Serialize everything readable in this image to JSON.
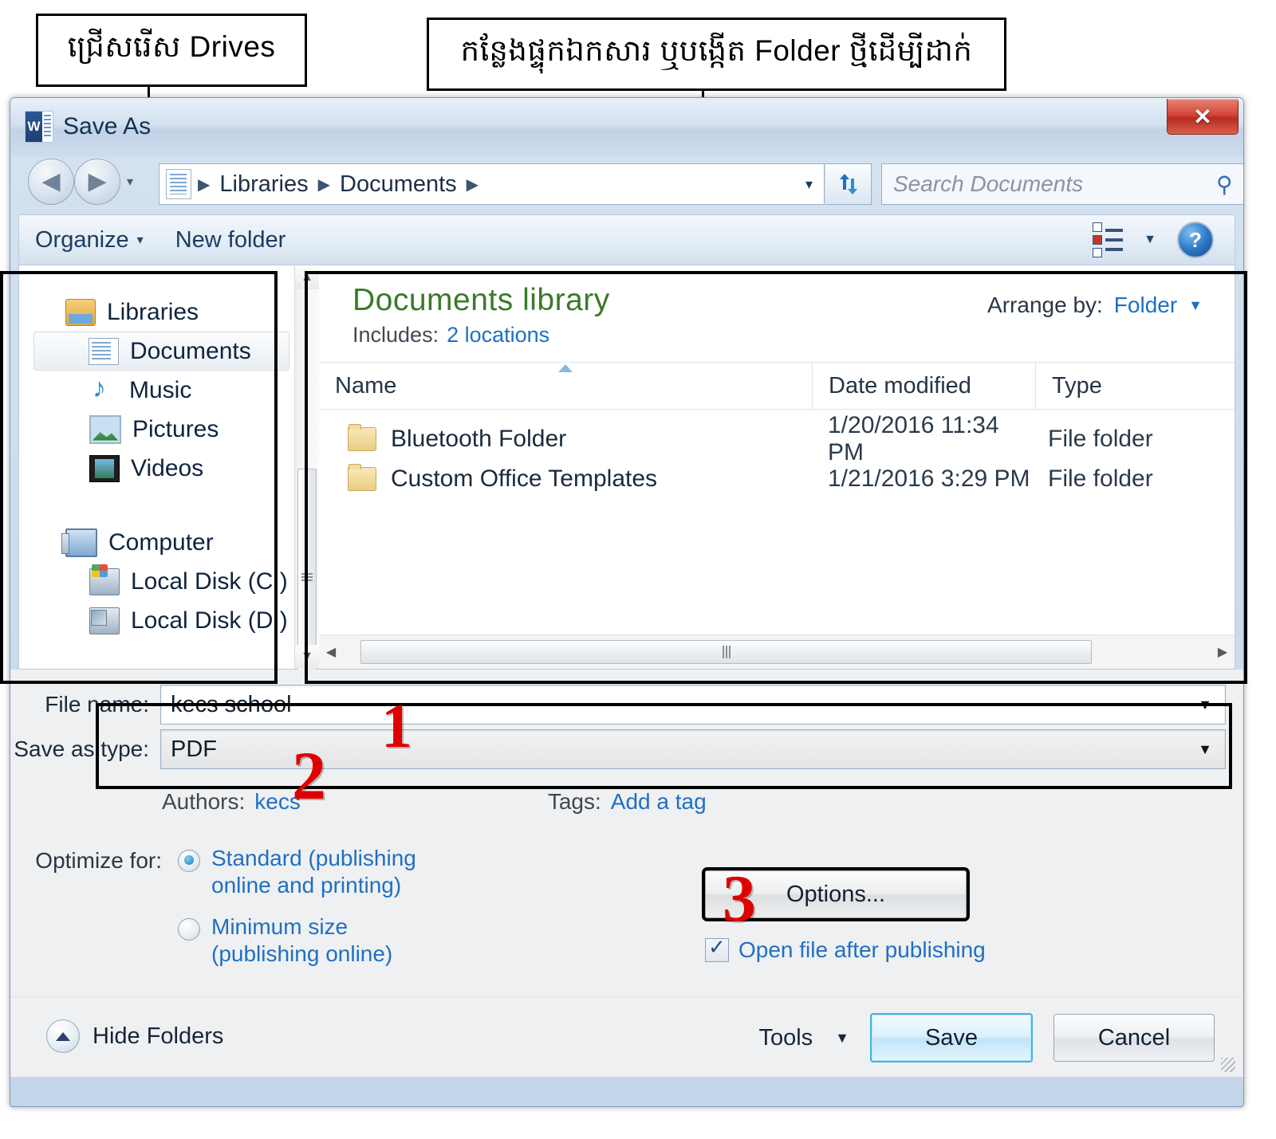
{
  "annotations": {
    "callout_drives": "ជ្រើសរើស Drives",
    "callout_folder": "កន្លែងផ្ទុកឯកសារ ឬបង្កើត Folder ថ្មីដើម្បីដាក់",
    "step_1": "1",
    "step_2": "2",
    "step_3": "3",
    "color": "#e00000"
  },
  "window": {
    "title": "Save As",
    "app_icon": "word-icon",
    "app_icon_letter": "W",
    "close_label": "✕"
  },
  "navbar": {
    "back_glyph": "◀",
    "forward_glyph": "▶",
    "history_caret": "▾",
    "breadcrumbs": [
      "Libraries",
      "Documents"
    ],
    "crumb_separator": "▶",
    "address_dropdown_caret": "▾",
    "refresh_glyph": "↯",
    "search_placeholder": "Search Documents",
    "search_icon": "search-icon",
    "search_glyph": "⚲"
  },
  "toolbar": {
    "organize_label": "Organize",
    "organize_caret": "▾",
    "new_folder_label": "New folder",
    "view_caret": "▼",
    "help_label": "?"
  },
  "sidebar": {
    "items": [
      {
        "label": "Libraries",
        "icon": "libraries-icon",
        "level": "root",
        "selected": false
      },
      {
        "label": "Documents",
        "icon": "document-icon",
        "level": "child",
        "selected": true
      },
      {
        "label": "Music",
        "icon": "music-note-icon",
        "level": "child",
        "selected": false
      },
      {
        "label": "Pictures",
        "icon": "picture-icon",
        "level": "child",
        "selected": false
      },
      {
        "label": "Videos",
        "icon": "video-icon",
        "level": "child",
        "selected": false
      },
      {
        "label": "Computer",
        "icon": "computer-icon",
        "level": "root",
        "selected": false
      },
      {
        "label": "Local Disk (C:)",
        "icon": "hard-disk-windows-icon",
        "level": "child",
        "selected": false
      },
      {
        "label": "Local Disk (D:)",
        "icon": "hard-disk-icon",
        "level": "child",
        "selected": false
      }
    ],
    "scroll_up_glyph": "▲",
    "scroll_down_glyph": "▼"
  },
  "filepane": {
    "library_title": "Documents library",
    "includes_label": "Includes:",
    "includes_value": "2 locations",
    "arrange_label": "Arrange by:",
    "arrange_value": "Folder",
    "arrange_caret": "▼",
    "columns": [
      "Name",
      "Date modified",
      "Type"
    ],
    "rows": [
      {
        "name": "Bluetooth Folder",
        "date": "1/20/2016 11:34 PM",
        "type": "File folder",
        "icon": "folder-icon"
      },
      {
        "name": "Custom Office Templates",
        "date": "1/21/2016 3:29 PM",
        "type": "File folder",
        "icon": "folder-icon"
      }
    ],
    "hscroll_left_glyph": "◀",
    "hscroll_right_glyph": "▶"
  },
  "form": {
    "file_name_label": "File name:",
    "file_name_value": "kecs school",
    "save_as_type_label": "Save as type:",
    "save_as_type_value": "PDF",
    "dropdown_caret": "▼",
    "authors_label": "Authors:",
    "authors_value": "kecs",
    "tags_label": "Tags:",
    "tags_value": "Add a tag",
    "optimize_label": "Optimize for:",
    "radio_standard": "Standard (publishing online and printing)",
    "radio_standard_line1": "Standard (publishing",
    "radio_standard_line2": "online and printing)",
    "radio_standard_selected": true,
    "radio_minimum": "Minimum size (publishing online)",
    "radio_minimum_line1": "Minimum size",
    "radio_minimum_line2": "(publishing online)",
    "radio_minimum_selected": false,
    "options_button": "Options...",
    "open_after_publishing_label": "Open file after publishing",
    "open_after_publishing_checked": true
  },
  "footer": {
    "hide_folders_label": "Hide Folders",
    "hide_folders_icon": "chevron-up-icon",
    "tools_label": "Tools",
    "tools_caret": "▼",
    "save_label": "Save",
    "cancel_label": "Cancel"
  }
}
